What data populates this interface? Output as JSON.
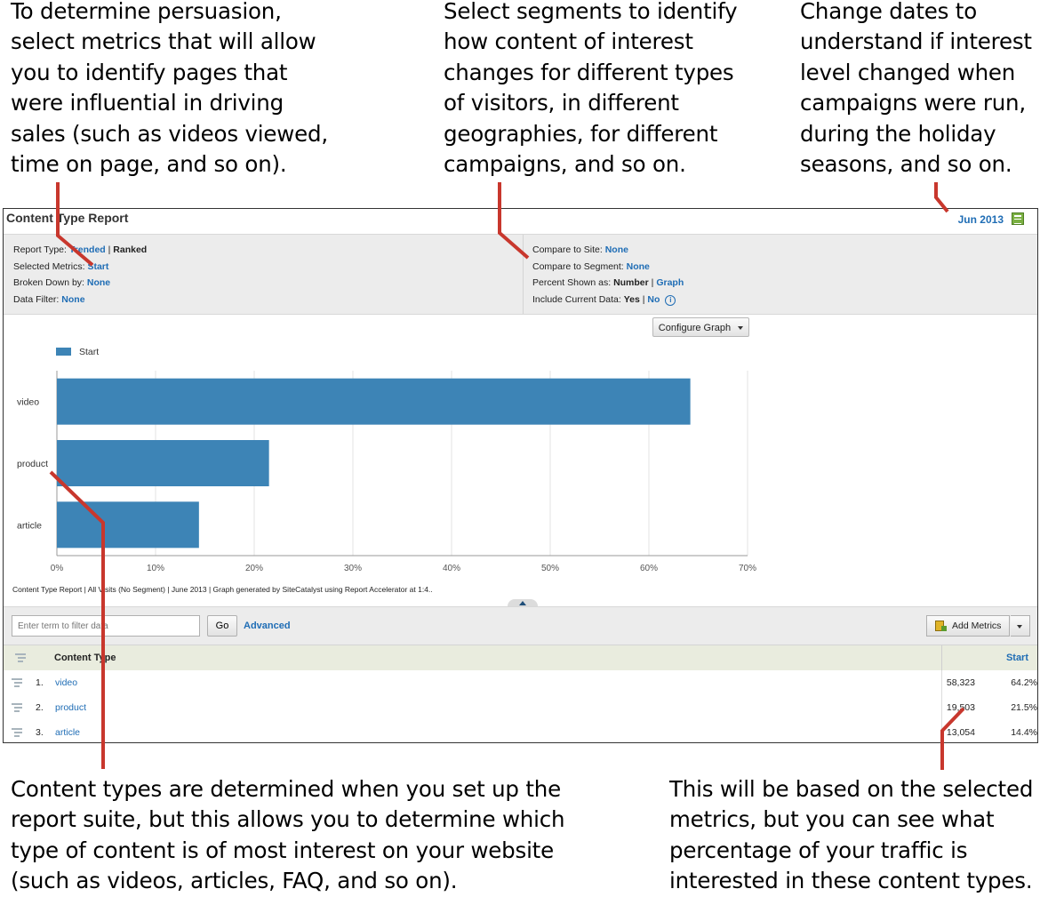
{
  "callouts": {
    "metrics": "To determine persuasion,\nselect metrics that will allow\nyou to identify pages that\nwere influential in driving\nsales (such as videos viewed,\ntime on page, and so on).",
    "segments": "Select segments to identify\nhow content of interest\nchanges for different types\nof visitors, in different\ngeographies, for different\ncampaigns, and so on.",
    "dates": "Change dates to\nunderstand if interest\nlevel changed when\ncampaigns were run,\nduring the holiday\nseasons, and so on.",
    "content_types": "Content types are determined when you set up the\nreport suite, but this allows you to determine which\ntype of content is of most interest on your website\n(such as videos, articles, FAQ, and so on).",
    "percentage": "This will be based on the selected\nmetrics, but you can see what\npercentage of your traffic is\ninterested in these content types."
  },
  "callout_color": "#c8372d",
  "report": {
    "title": "Content Type Report",
    "date": "Jun 2013",
    "date_icon": "calendar-icon"
  },
  "settings": {
    "report_type_label": "Report Type:",
    "report_type_trended": "Trended",
    "sep": "|",
    "report_type_ranked": "Ranked",
    "selected_metrics_label": "Selected Metrics:",
    "selected_metrics_value": "Start",
    "broken_down_label": "Broken Down by:",
    "broken_down_value": "None",
    "data_filter_label": "Data Filter:",
    "data_filter_value": "None",
    "compare_site_label": "Compare to Site:",
    "compare_site_value": "None",
    "compare_segment_label": "Compare to Segment:",
    "compare_segment_value": "None",
    "percent_shown_label": "Percent Shown as:",
    "percent_shown_number": "Number",
    "percent_shown_graph": "Graph",
    "include_current_label": "Include Current Data:",
    "include_current_yes": "Yes",
    "include_current_no": "No",
    "info_icon": "i"
  },
  "configure_graph_label": "Configure Graph",
  "chart_data": {
    "type": "bar",
    "orientation": "horizontal",
    "categories": [
      "video",
      "product",
      "article"
    ],
    "series": [
      {
        "name": "Start",
        "values": [
          64.2,
          21.5,
          14.4
        ],
        "color": "#3d84b6"
      }
    ],
    "xlim": [
      0,
      70
    ],
    "xticks": [
      "0%",
      "10%",
      "20%",
      "30%",
      "40%",
      "50%",
      "60%",
      "70%"
    ],
    "grid": true,
    "legend": "top-left",
    "footer": "Content Type Report | All Visits (No Segment) | June 2013 | Graph generated by SiteCatalyst using Report Accelerator at  1:4.."
  },
  "toolbar": {
    "filter_placeholder": "Enter term to filter data",
    "go_label": "Go",
    "advanced_label": "Advanced",
    "add_metrics_label": "Add Metrics"
  },
  "table": {
    "col_type": "Content Type",
    "col_metric": "Start",
    "rows": [
      {
        "num": "1.",
        "name": "video",
        "value": "58,323",
        "pct": "64.2%"
      },
      {
        "num": "2.",
        "name": "product",
        "value": "19,503",
        "pct": "21.5%"
      },
      {
        "num": "3.",
        "name": "article",
        "value": "13,054",
        "pct": "14.4%"
      }
    ]
  }
}
